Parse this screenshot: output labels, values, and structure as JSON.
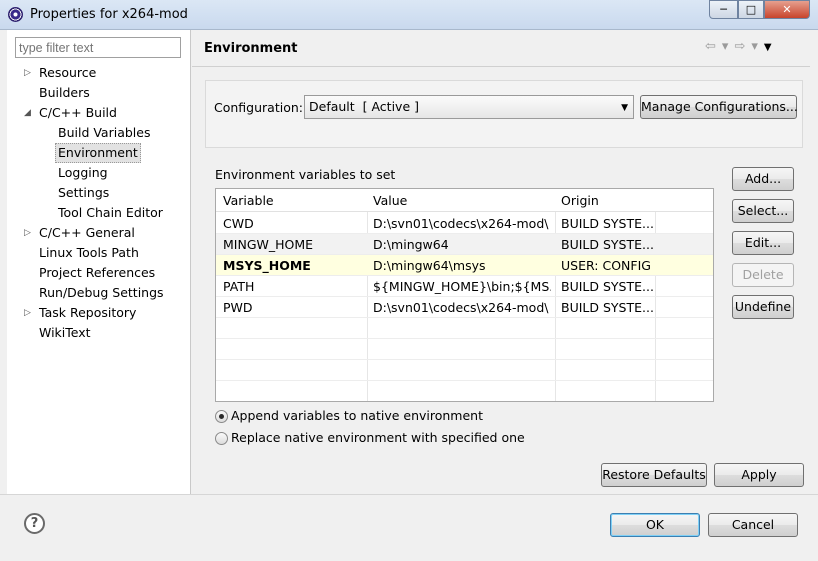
{
  "window": {
    "title": "Properties for x264-mod",
    "minimize": "─",
    "maximize": "□",
    "close": "✕"
  },
  "filter": {
    "placeholder": "type filter text"
  },
  "tree": [
    {
      "label": "Resource",
      "level": 0,
      "expander": "▷"
    },
    {
      "label": "Builders",
      "level": 0,
      "expander": ""
    },
    {
      "label": "C/C++ Build",
      "level": 0,
      "expander": "◢"
    },
    {
      "label": "Build Variables",
      "level": 1,
      "expander": ""
    },
    {
      "label": "Environment",
      "level": 1,
      "expander": "",
      "selected": true
    },
    {
      "label": "Logging",
      "level": 1,
      "expander": ""
    },
    {
      "label": "Settings",
      "level": 1,
      "expander": ""
    },
    {
      "label": "Tool Chain Editor",
      "level": 1,
      "expander": ""
    },
    {
      "label": "C/C++ General",
      "level": 0,
      "expander": "▷"
    },
    {
      "label": "Linux Tools Path",
      "level": 0,
      "expander": ""
    },
    {
      "label": "Project References",
      "level": 0,
      "expander": ""
    },
    {
      "label": "Run/Debug Settings",
      "level": 0,
      "expander": ""
    },
    {
      "label": "Task Repository",
      "level": 0,
      "expander": "▷"
    },
    {
      "label": "WikiText",
      "level": 0,
      "expander": ""
    }
  ],
  "page": {
    "title": "Environment",
    "nav": {
      "back": "⇦",
      "back_menu": "▾",
      "forward": "⇨",
      "forward_menu": "▾",
      "view_menu": "▼"
    }
  },
  "configuration": {
    "label": "Configuration:",
    "selected": "Default  [ Active ]",
    "caret": "▼",
    "manage_button": "Manage Configurations..."
  },
  "variables": {
    "section_label": "Environment variables to set",
    "columns": [
      "Variable",
      "Value",
      "Origin"
    ],
    "rows": [
      {
        "variable": "CWD",
        "value": "D:\\svn01\\codecs\\x264-mod\\",
        "origin": "BUILD SYSTE..."
      },
      {
        "variable": "MINGW_HOME",
        "value": "D:\\mingw64",
        "origin": "BUILD SYSTE..."
      },
      {
        "variable": "MSYS_HOME",
        "value": "D:\\mingw64\\msys",
        "origin": "USER: CONFIG"
      },
      {
        "variable": "PATH",
        "value": "${MINGW_HOME}\\bin;${MS...",
        "origin": "BUILD SYSTE..."
      },
      {
        "variable": "PWD",
        "value": "D:\\svn01\\codecs\\x264-mod\\",
        "origin": "BUILD SYSTE..."
      }
    ],
    "buttons": {
      "add": "Add...",
      "select": "Select...",
      "edit": "Edit...",
      "delete": "Delete",
      "undefine": "Undefine"
    }
  },
  "mode": {
    "append": "Append variables to native environment",
    "replace": "Replace native environment with specified one",
    "selected": "append"
  },
  "page_buttons": {
    "restore": "Restore Defaults",
    "apply": "Apply"
  },
  "dialog_buttons": {
    "help": "?",
    "ok": "OK",
    "cancel": "Cancel"
  },
  "colors": {
    "highlight_row": "#ffffe0",
    "title_bar": "#dbe7f5"
  }
}
